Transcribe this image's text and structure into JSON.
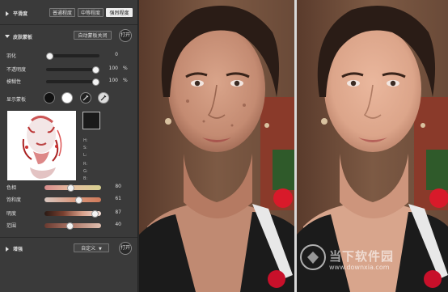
{
  "section_smooth": {
    "title": "平滑度",
    "buttons": [
      "普通程度",
      "中等程度",
      "强烈程度"
    ],
    "selected": "强烈程度"
  },
  "section_mask": {
    "title": "皮肤蒙板",
    "auto_mask_button": "自动蒙板关闭",
    "open_button": "打开",
    "sliders": [
      {
        "label": "羽化",
        "value": "0",
        "unit": "",
        "level": 0.0
      },
      {
        "label": "不透明度",
        "value": "100",
        "unit": "%",
        "level": 1.0
      },
      {
        "label": "模糊性",
        "value": "100",
        "unit": "%",
        "level": 1.0
      }
    ],
    "show_mask_label": "显示蒙板",
    "info_labels": [
      "H:",
      "S:",
      "L:",
      "R:",
      "G:",
      "B:"
    ],
    "color_sliders": [
      {
        "label": "色相",
        "value": "80",
        "level": 0.46
      },
      {
        "label": "饱和度",
        "value": "61",
        "level": 0.63
      },
      {
        "label": "明度",
        "value": "87",
        "level": 0.95
      },
      {
        "label": "范围",
        "value": "40",
        "level": 0.44
      }
    ]
  },
  "section_enhance": {
    "title": "增强",
    "preset_select": "自定义",
    "open_button": "打开"
  },
  "preview": {
    "watermark_caption": "当下软件园",
    "watermark_url": "www.downxia.com"
  },
  "colors": {
    "panel_bg": "#3a3a3a",
    "selected_button_bg": "#eeeeee",
    "color_swatch": "#1a1a1a"
  }
}
